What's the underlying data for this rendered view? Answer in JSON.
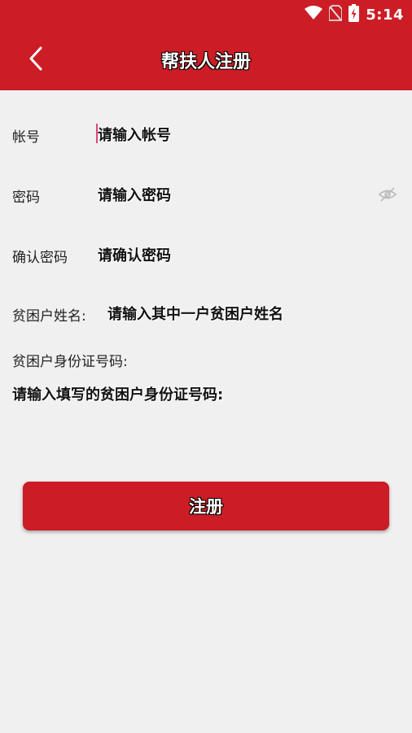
{
  "status_bar": {
    "time": "5:14",
    "icons": [
      "wifi-icon",
      "no-sim-icon",
      "battery-charging-icon"
    ]
  },
  "header": {
    "title": "帮扶人注册",
    "back_icon": "chevron-left-icon"
  },
  "colors": {
    "primary": "#cc1c25",
    "background": "#f0f0f0"
  },
  "form": {
    "account": {
      "label": "帐号",
      "placeholder": "请输入帐号"
    },
    "password": {
      "label": "密码",
      "placeholder": "请输入密码",
      "toggle_icon": "eye-off-icon"
    },
    "confirm_password": {
      "label": "确认密码",
      "placeholder": "请确认密码"
    },
    "poor_household_name": {
      "label": "贫困户姓名:",
      "placeholder": "请输入其中一户贫困户姓名"
    },
    "poor_household_id": {
      "label": "贫困户身份证号码:",
      "placeholder": "请输入填写的贫困户身份证号码:"
    }
  },
  "register_button": {
    "label": "注册"
  }
}
